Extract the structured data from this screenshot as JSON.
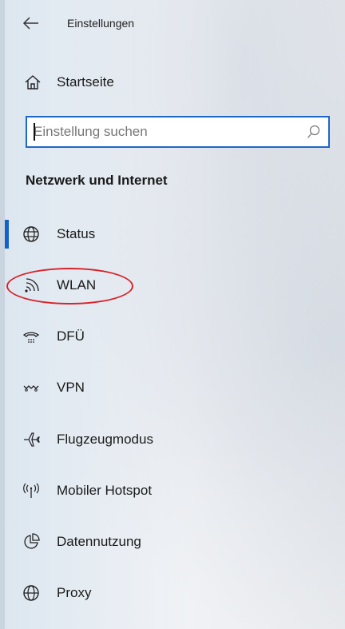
{
  "window": {
    "title": "Einstellungen"
  },
  "home": {
    "label": "Startseite"
  },
  "search": {
    "placeholder": "Einstellung suchen",
    "value": ""
  },
  "section": {
    "heading": "Netzwerk und Internet"
  },
  "nav": {
    "items": [
      {
        "label": "Status",
        "icon": "globe-icon",
        "selected": true
      },
      {
        "label": "WLAN",
        "icon": "wifi-icon",
        "selected": false,
        "highlighted": true
      },
      {
        "label": "DFÜ",
        "icon": "dialup-icon",
        "selected": false
      },
      {
        "label": "VPN",
        "icon": "vpn-icon",
        "selected": false
      },
      {
        "label": "Flugzeugmodus",
        "icon": "airplane-icon",
        "selected": false
      },
      {
        "label": "Mobiler Hotspot",
        "icon": "hotspot-icon",
        "selected": false
      },
      {
        "label": "Datennutzung",
        "icon": "data-usage-icon",
        "selected": false
      },
      {
        "label": "Proxy",
        "icon": "proxy-globe-icon",
        "selected": false
      }
    ]
  },
  "colors": {
    "accent": "#0f62c9",
    "annotation": "#d8232a",
    "text": "#1a1a1a"
  }
}
